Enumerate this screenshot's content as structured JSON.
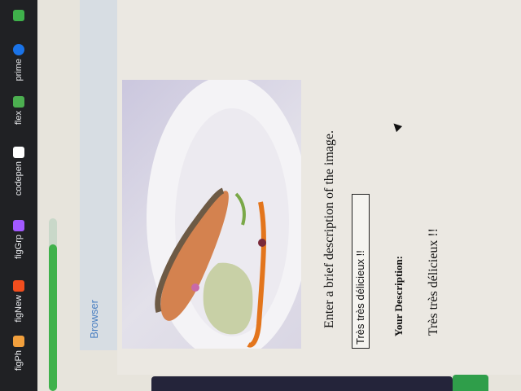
{
  "bookmarks": [
    {
      "label": "figPh",
      "color": "#f2a03d"
    },
    {
      "label": "figNew",
      "color": "#f24e1e"
    },
    {
      "label": "figGrp",
      "color": "#a259ff"
    },
    {
      "label": "codepen",
      "color": "#ffffff"
    },
    {
      "label": "flex",
      "color": "#4caf50"
    },
    {
      "label": "prime",
      "color": "#1a73e8"
    }
  ],
  "browser_panel": {
    "label": "Browser"
  },
  "form": {
    "prompt": "Enter a brief description of the image.",
    "input_value": "Très très délicieux !!",
    "your_description_label": "Your Description:",
    "result_text": "Très très délicieux !!"
  },
  "colors": {
    "accent_green": "#3fb14b",
    "link_blue": "#4a7fc1"
  }
}
